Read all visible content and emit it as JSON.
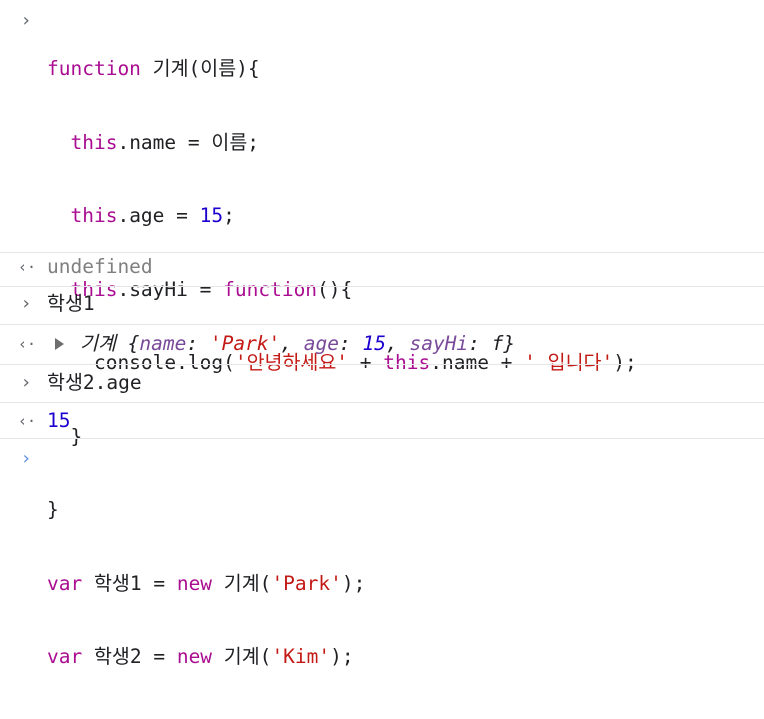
{
  "entries": {
    "input1": {
      "lines": [
        "function 기계(이름){",
        "  this.name = 이름;",
        "  this.age = 15;",
        "  this.sayHi = function(){",
        "    console.log('안녕하세요' + this.name + ' 입니다');",
        "  }",
        "}",
        "var 학생1 = new 기계('Park');",
        "var 학생2 = new 기계('Kim');"
      ]
    },
    "output1": {
      "text": "undefined"
    },
    "input2": {
      "text": "학생1"
    },
    "output2": {
      "constructor": "기계",
      "open_brace": "{",
      "key_name": "name",
      "val_name": "'Park'",
      "key_age": "age",
      "val_age": "15",
      "key_sayHi": "sayHi",
      "val_sayHi": "f",
      "close_brace": "}"
    },
    "input3": {
      "text": "학생2.age"
    },
    "output3": {
      "text": "15"
    }
  },
  "prompts": {
    "input_glyph": "›",
    "output_glyph": "‹·",
    "active_glyph": "›"
  },
  "colors": {
    "keyword": "#aa0d91",
    "string": "#c41a16",
    "number": "#1c00cf",
    "undefined": "#808080",
    "prompt_active": "#5b8fdc"
  }
}
